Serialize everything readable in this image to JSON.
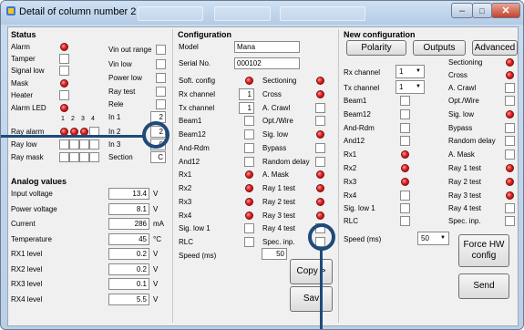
{
  "window": {
    "title": "Detail of column number 2"
  },
  "status": {
    "header": "Status",
    "left_rows": [
      "Alarm",
      "Tamper",
      "Signal low",
      "Mask",
      "Heater",
      "Alarm LED"
    ],
    "channel_numbers": [
      "1",
      "2",
      "3",
      "4"
    ],
    "bottom_rows": [
      "Ray alarm",
      "Ray low",
      "Ray mask"
    ],
    "mid_rows": [
      "Vin out range",
      "Vin low",
      "Power low",
      "Ray test",
      "Rele",
      "In 1",
      "In 2",
      "In 3",
      "Section"
    ],
    "values": {
      "in1": "2",
      "in2": "2",
      "in3": "0",
      "section": "C"
    }
  },
  "analog": {
    "header": "Analog values",
    "rows": [
      {
        "label": "Input voltage",
        "value": "13.4",
        "unit": "V"
      },
      {
        "label": "Power voltage",
        "value": "8.1",
        "unit": "V"
      },
      {
        "label": "Current",
        "value": "286",
        "unit": "mA"
      },
      {
        "label": "Temperature",
        "value": "45",
        "unit": "°C"
      },
      {
        "label": "RX1 level",
        "value": "0.2",
        "unit": "V"
      },
      {
        "label": "RX2 level",
        "value": "0.2",
        "unit": "V"
      },
      {
        "label": "RX3 level",
        "value": "0.1",
        "unit": "V"
      },
      {
        "label": "RX4 level",
        "value": "5.5",
        "unit": "V"
      }
    ]
  },
  "configuration": {
    "header": "Configuration",
    "model_label": "Model",
    "model_value": "Mana",
    "serial_label": "Serial No.",
    "serial_value": "000102",
    "left_rows": [
      "Soft. config",
      "Rx channel",
      "Tx channel",
      "Beam1",
      "Beam12",
      "And-Rdm",
      "And12",
      "Rx1",
      "Rx2",
      "Rx3",
      "Rx4",
      "Sig. low 1",
      "RLC"
    ],
    "rx_channel_value": "1",
    "tx_channel_value": "1",
    "right_rows": [
      "Sectioning",
      "Cross",
      "A. Crawl",
      "Opt./Wire",
      "Sig. low",
      "Bypass",
      "Random delay",
      "A. Mask",
      "Ray 1 test",
      "Ray 2 test",
      "Ray 3 test",
      "Ray 4 test",
      "Spec. inp."
    ],
    "speed_label": "Speed (ms)",
    "speed_value": "50",
    "copy_button": "Copy >",
    "save_button": "Sav"
  },
  "new_configuration": {
    "header": "New configuration",
    "tabs": [
      "Polarity",
      "Outputs",
      "Advanced"
    ],
    "rx_channel_label": "Rx channel",
    "rx_channel_value": "1",
    "tx_channel_label": "Tx channel",
    "tx_channel_value": "1",
    "left_rows": [
      "Beam1",
      "Beam12",
      "And-Rdm",
      "And12",
      "Rx1",
      "Rx2",
      "Rx3",
      "Rx4",
      "Sig. low 1",
      "RLC"
    ],
    "right_rows": [
      "Sectioning",
      "Cross",
      "A. Crawl",
      "Opt./Wire",
      "Sig. low",
      "Bypass",
      "Random delay",
      "A. Mask",
      "Ray 1 test",
      "Ray 2 test",
      "Ray 3 test",
      "Ray 4 test",
      "Spec. inp."
    ],
    "speed_label": "Speed (ms)",
    "speed_value": "50",
    "force_button": "Force HW config",
    "send_button": "Send"
  },
  "colors": {
    "led": "#e02020",
    "annotation": "#1f4a7a",
    "window_frame": "#b9cfe8"
  }
}
